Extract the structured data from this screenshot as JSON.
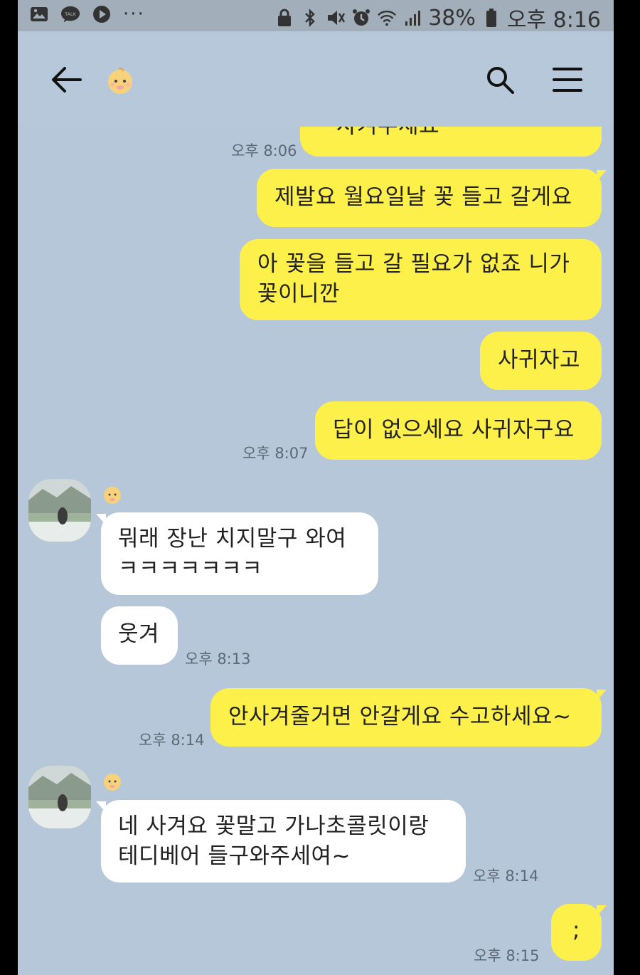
{
  "statusbar": {
    "left_icons": [
      "image-icon",
      "talk-icon",
      "play-icon",
      "more-icon"
    ],
    "more": "···",
    "battery": "38%",
    "time": "오후 8:16"
  },
  "header": {
    "back_icon": "back-arrow-icon",
    "friend_icon": "baby-emoji-icon",
    "search_icon": "search-icon",
    "menu_icon": "menu-icon"
  },
  "messages": [
    {
      "side": "me",
      "text": "사겨주세요",
      "time": "오후 8:06"
    },
    {
      "side": "me",
      "text": "제발요 월요일날 꽃 들고 갈게요"
    },
    {
      "side": "me",
      "lines": [
        "아 꽃을 들고 갈 필요가 없죠 니가",
        "꽃이니깐"
      ]
    },
    {
      "side": "me",
      "text": "사귀자고"
    },
    {
      "side": "me",
      "text": "답이 없으세요 사귀자구요",
      "time": "오후 8:07"
    },
    {
      "side": "them",
      "lines": [
        "뭐래 장난 치지말구 와여",
        "ㅋㅋㅋㅋㅋㅋㅋ"
      ]
    },
    {
      "side": "them",
      "text": "웃겨",
      "time": "오후 8:13"
    },
    {
      "side": "me",
      "text": "안사겨줄거면 안갈게요 수고하세요~",
      "time": "오후 8:14"
    },
    {
      "side": "them",
      "lines": [
        "네 사겨요 꽃말고 가나초콜릿이랑",
        "테디베어 들구와주세여~"
      ],
      "time": "오후 8:14"
    },
    {
      "side": "me",
      "text": ";",
      "time": "오후 8:15"
    }
  ],
  "colors": {
    "chat_bg": "#b6c7da",
    "my_bubble": "#fef04a",
    "their_bubble": "#ffffff",
    "statusbar_bg": "#a3aebb"
  }
}
